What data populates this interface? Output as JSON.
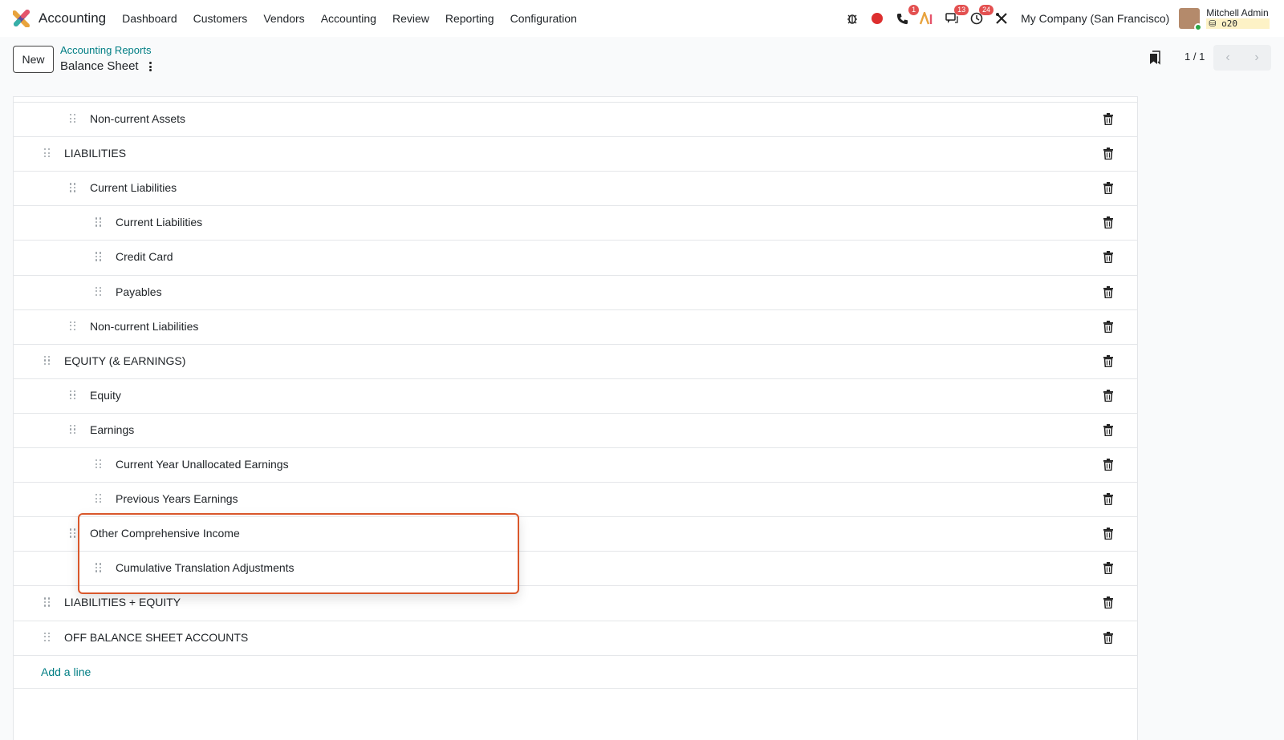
{
  "navbar": {
    "app_title": "Accounting",
    "menu": [
      "Dashboard",
      "Customers",
      "Vendors",
      "Accounting",
      "Review",
      "Reporting",
      "Configuration"
    ],
    "systray": {
      "phone_badge": "1",
      "chat_badge": "13",
      "activity_badge": "24"
    },
    "company": "My Company (San Francisco)",
    "user_name": "Mitchell Admin",
    "user_db": "o20"
  },
  "control": {
    "new_label": "New",
    "breadcrumb": "Accounting Reports",
    "title": "Balance Sheet",
    "pager": "1 / 1"
  },
  "lines": [
    {
      "label": "Non-current Assets",
      "level": 1
    },
    {
      "label": "LIABILITIES",
      "level": 0
    },
    {
      "label": "Current Liabilities",
      "level": 1
    },
    {
      "label": "Current Liabilities",
      "level": 2
    },
    {
      "label": "Credit Card",
      "level": 2
    },
    {
      "label": "Payables",
      "level": 2
    },
    {
      "label": "Non-current Liabilities",
      "level": 1
    },
    {
      "label": "EQUITY (& EARNINGS)",
      "level": 0
    },
    {
      "label": "Equity",
      "level": 1
    },
    {
      "label": "Earnings",
      "level": 1
    },
    {
      "label": "Current Year Unallocated Earnings",
      "level": 2
    },
    {
      "label": "Previous Years Earnings",
      "level": 2
    },
    {
      "label": "Other Comprehensive Income",
      "level": 1
    },
    {
      "label": "Cumulative Translation Adjustments",
      "level": 2
    },
    {
      "label": "LIABILITIES + EQUITY",
      "level": 0
    },
    {
      "label": "OFF BALANCE SHEET ACCOUNTS",
      "level": 0
    }
  ],
  "add_line": "Add a line",
  "colors": {
    "link": "#017e84",
    "highlight": "#d9572b",
    "badge": "#e35050"
  }
}
